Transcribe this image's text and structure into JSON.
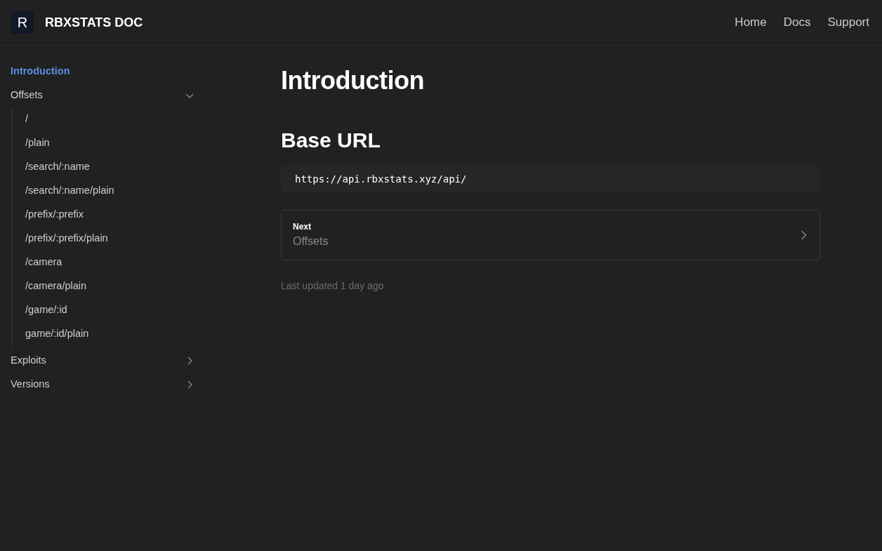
{
  "brand": {
    "logo_letter": "R",
    "title": "RBXSTATS DOC"
  },
  "nav": [
    "Home",
    "Docs",
    "Support"
  ],
  "sidebar": {
    "items": [
      {
        "label": "Introduction",
        "selected": true
      },
      {
        "label": "Offsets",
        "selected": false,
        "expanded": true,
        "children": [
          {
            "label": "/",
            "selected": false
          },
          {
            "label": "/plain",
            "selected": false
          },
          {
            "label": "/search/:name",
            "selected": false
          },
          {
            "label": "/search/:name/plain",
            "selected": false
          },
          {
            "label": "/prefix/:prefix",
            "selected": false
          },
          {
            "label": "/prefix/:prefix/plain",
            "selected": false
          },
          {
            "label": "/camera",
            "selected": false
          },
          {
            "label": "/camera/plain",
            "selected": false
          },
          {
            "label": "/game/:id",
            "selected": false
          },
          {
            "label": "game/:id/plain",
            "selected": false
          }
        ]
      },
      {
        "label": "Exploits",
        "selected": false,
        "expanded": false
      },
      {
        "label": "Versions",
        "selected": false,
        "expanded": false
      }
    ]
  },
  "page": {
    "title": "Introduction",
    "section_title": "Base URL",
    "code": "https://api.rbxstats.xyz/api/",
    "next": {
      "caption": "Next",
      "label": "Offsets"
    },
    "last_updated": "Last updated 1 day ago"
  }
}
